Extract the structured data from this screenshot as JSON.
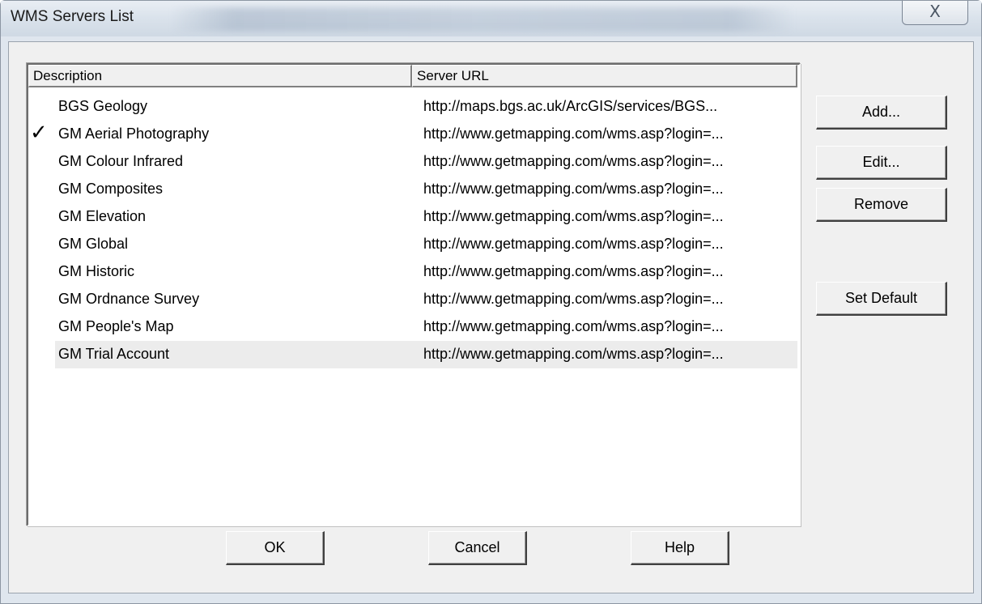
{
  "window": {
    "title": "WMS Servers List",
    "close_glyph": "X"
  },
  "listview": {
    "columns": [
      "Description",
      "Server URL"
    ],
    "rows": [
      {
        "checked": false,
        "description": "BGS Geology",
        "url": "http://maps.bgs.ac.uk/ArcGIS/services/BGS..."
      },
      {
        "checked": true,
        "description": "GM Aerial Photography",
        "url": "http://www.getmapping.com/wms.asp?login=..."
      },
      {
        "checked": false,
        "description": "GM Colour Infrared",
        "url": "http://www.getmapping.com/wms.asp?login=..."
      },
      {
        "checked": false,
        "description": "GM Composites",
        "url": "http://www.getmapping.com/wms.asp?login=..."
      },
      {
        "checked": false,
        "description": "GM Elevation",
        "url": "http://www.getmapping.com/wms.asp?login=..."
      },
      {
        "checked": false,
        "description": "GM Global",
        "url": "http://www.getmapping.com/wms.asp?login=..."
      },
      {
        "checked": false,
        "description": "GM Historic",
        "url": "http://www.getmapping.com/wms.asp?login=..."
      },
      {
        "checked": false,
        "description": "GM Ordnance Survey",
        "url": "http://www.getmapping.com/wms.asp?login=..."
      },
      {
        "checked": false,
        "description": "GM People's Map",
        "url": "http://www.getmapping.com/wms.asp?login=..."
      },
      {
        "checked": false,
        "highlighted": true,
        "description": "GM Trial Account",
        "url": "http://www.getmapping.com/wms.asp?login=..."
      }
    ],
    "check_glyph": "✓"
  },
  "side_buttons": {
    "add": "Add...",
    "edit": "Edit...",
    "remove": "Remove",
    "set_default": "Set Default"
  },
  "bottom_buttons": {
    "ok": "OK",
    "cancel": "Cancel",
    "help": "Help"
  }
}
